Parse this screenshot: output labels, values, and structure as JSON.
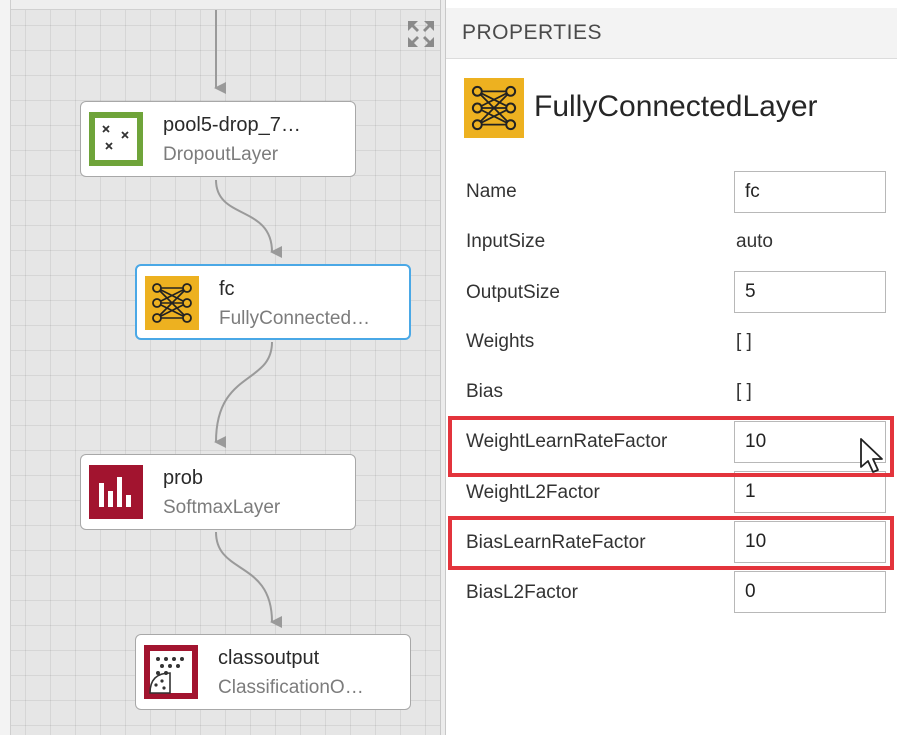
{
  "canvas": {
    "nodes": [
      {
        "id": "pool5",
        "title": "pool5-drop_7…",
        "subtitle": "DropoutLayer",
        "icon": "dropout-icon",
        "icon_color": "#6fa43a",
        "selected": false
      },
      {
        "id": "fc",
        "title": "fc",
        "subtitle": "FullyConnected…",
        "icon": "fully-connected-icon",
        "icon_color": "#edb120",
        "selected": true
      },
      {
        "id": "prob",
        "title": "prob",
        "subtitle": "SoftmaxLayer",
        "icon": "softmax-icon",
        "icon_color": "#a2142f",
        "selected": false
      },
      {
        "id": "classoutput",
        "title": "classoutput",
        "subtitle": "ClassificationO…",
        "icon": "classification-icon",
        "icon_color": "#a2142f",
        "selected": false
      }
    ],
    "selection_color": "#4aa8e6",
    "expand_icon": "expand-arrows-icon"
  },
  "properties": {
    "header": "PROPERTIES",
    "layer_type": "FullyConnectedLayer",
    "layer_icon": "fully-connected-icon",
    "fields": {
      "name": {
        "label": "Name",
        "value": "fc"
      },
      "input_size": {
        "label": "InputSize",
        "value": "auto"
      },
      "output_size": {
        "label": "OutputSize",
        "value": "5"
      },
      "weights": {
        "label": "Weights",
        "value": "[ ]"
      },
      "bias": {
        "label": "Bias",
        "value": "[ ]"
      },
      "weight_learn_rate_factor": {
        "label": "WeightLearnRateFactor",
        "value": "10"
      },
      "weight_l2_factor": {
        "label": "WeightL2Factor",
        "value": "1"
      },
      "bias_learn_rate_factor": {
        "label": "BiasLearnRateFactor",
        "value": "10"
      },
      "bias_l2_factor": {
        "label": "BiasL2Factor",
        "value": "0"
      }
    },
    "highlight_color": "#e3343c"
  }
}
